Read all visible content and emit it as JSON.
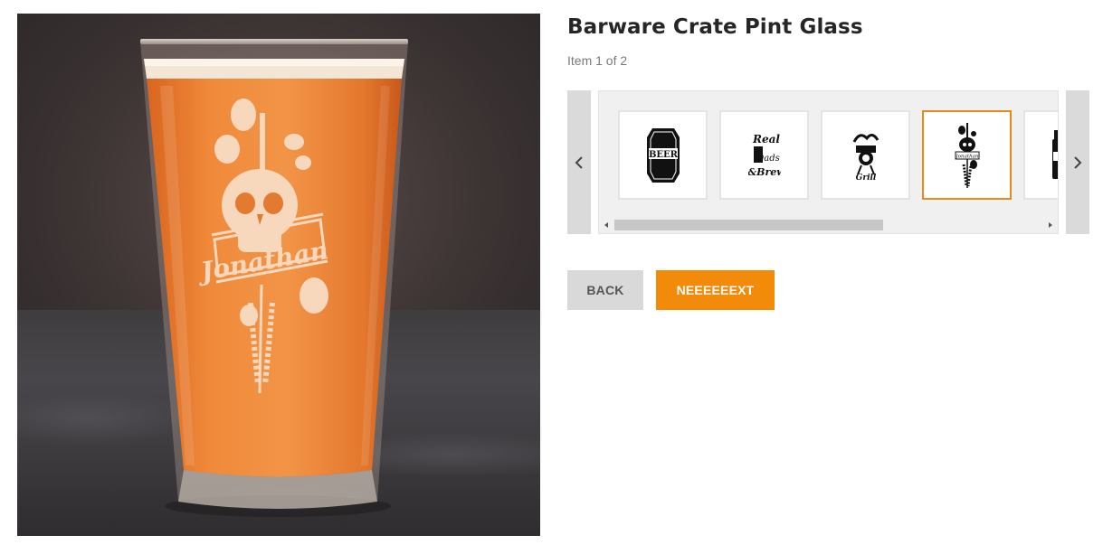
{
  "product": {
    "title": "Barware Crate Pint Glass",
    "item_count": "Item 1 of 2",
    "engraving_name": "Jonathan"
  },
  "carousel": {
    "prev_icon": "chevron-left-icon",
    "next_icon": "chevron-right-icon",
    "designs": [
      {
        "name": "beer-label-design",
        "text": "BEER",
        "selected": false
      },
      {
        "name": "real-dads-brew-design",
        "text": "Real Dads Brew",
        "selected": false
      },
      {
        "name": "grill-design",
        "text": "Grill",
        "selected": false
      },
      {
        "name": "skull-hops-design",
        "text": "Jonathan",
        "selected": true
      },
      {
        "name": "bottle-design",
        "text": "",
        "selected": false
      }
    ],
    "selected_index": 3
  },
  "buttons": {
    "back_label": "BACK",
    "next_label": "NEEEEEEXT"
  },
  "colors": {
    "accent": "#f28a0a",
    "selected_border": "#e8891e",
    "back_button": "#d9d9d9",
    "beer": "#e88a2e"
  }
}
